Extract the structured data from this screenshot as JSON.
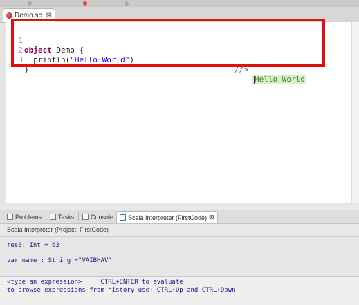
{
  "editor": {
    "tab_title": "Demo.sc",
    "tab_close": "⊠",
    "lines": [
      {
        "num": "1",
        "keyword": "object",
        "text": " Demo {"
      },
      {
        "num": "2",
        "text_before": "  println(",
        "string": "\"Hello World\"",
        "text_after": ")",
        "comment": "//>",
        "result": "Hello World"
      },
      {
        "num": "3",
        "text": "}"
      }
    ]
  },
  "colors": {
    "highlight_box": "#e20f0f",
    "keyword": "#7f0055",
    "string": "#2a00ff",
    "result_bg": "#d9f0c8"
  },
  "panel": {
    "tabs": [
      {
        "label": "Problems",
        "icon": "problems-icon"
      },
      {
        "label": "Tasks",
        "icon": "tasks-icon"
      },
      {
        "label": "Console",
        "icon": "console-icon"
      },
      {
        "label": "Scala Interpreter (FirstCode)",
        "icon": "scala-interpreter-icon",
        "close": "⊠"
      }
    ],
    "interpreter_title": "Scala Interpreter (Project: FirstCode)",
    "output": [
      "res3: Int = 63",
      "var name : String =\"VAIBHAV\""
    ],
    "hints": [
      "<type an expression>     CTRL+ENTER to evaluate",
      "to browse expressions from history use: CTRL+Up and CTRL+Down"
    ]
  }
}
